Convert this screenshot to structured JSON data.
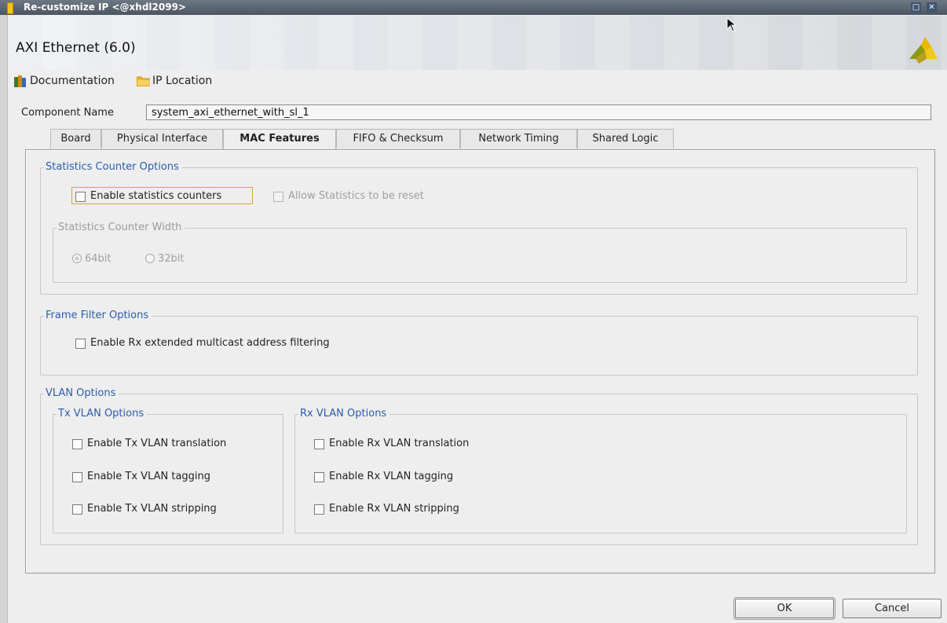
{
  "window": {
    "title": "Re-customize IP <@xhdl2099>",
    "controls": [
      "maximize-icon",
      "close-icon"
    ]
  },
  "header": {
    "ip_title": "AXI Ethernet (6.0)",
    "logo": "xilinx-logo-icon"
  },
  "links": {
    "documentation": "Documentation",
    "ip_location": "IP Location"
  },
  "component": {
    "label": "Component Name",
    "value": "system_axi_ethernet_with_sl_1"
  },
  "tabs": [
    {
      "label": "Board",
      "active": false
    },
    {
      "label": "Physical Interface",
      "active": false
    },
    {
      "label": "MAC Features",
      "active": true
    },
    {
      "label": "FIFO & Checksum",
      "active": false
    },
    {
      "label": "Network Timing",
      "active": false
    },
    {
      "label": "Shared Logic",
      "active": false
    }
  ],
  "statistics": {
    "legend": "Statistics Counter Options",
    "enable_counters": {
      "label": "Enable statistics counters",
      "checked": false,
      "enabled": true
    },
    "allow_reset": {
      "label": "Allow Statistics to be reset",
      "checked": false,
      "enabled": false
    },
    "width_legend": "Statistics Counter Width",
    "width_options": [
      {
        "label": "64bit",
        "selected": true
      },
      {
        "label": "32bit",
        "selected": false
      }
    ]
  },
  "frame_filter": {
    "legend": "Frame Filter Options",
    "multicast": {
      "label": "Enable Rx extended multicast address filtering",
      "checked": false
    }
  },
  "vlan": {
    "legend": "VLAN Options",
    "tx": {
      "legend": "Tx VLAN Options",
      "items": [
        {
          "label": "Enable Tx VLAN translation",
          "checked": false
        },
        {
          "label": "Enable Tx VLAN tagging",
          "checked": false
        },
        {
          "label": "Enable Tx VLAN stripping",
          "checked": false
        }
      ]
    },
    "rx": {
      "legend": "Rx VLAN Options",
      "items": [
        {
          "label": "Enable Rx VLAN translation",
          "checked": false
        },
        {
          "label": "Enable Rx VLAN tagging",
          "checked": false
        },
        {
          "label": "Enable Rx VLAN stripping",
          "checked": false
        }
      ]
    }
  },
  "buttons": {
    "ok": "OK",
    "cancel": "Cancel"
  },
  "colors": {
    "legend": "#2b5cab",
    "titlebar": "#55606c",
    "focus": "#d9a43a"
  }
}
